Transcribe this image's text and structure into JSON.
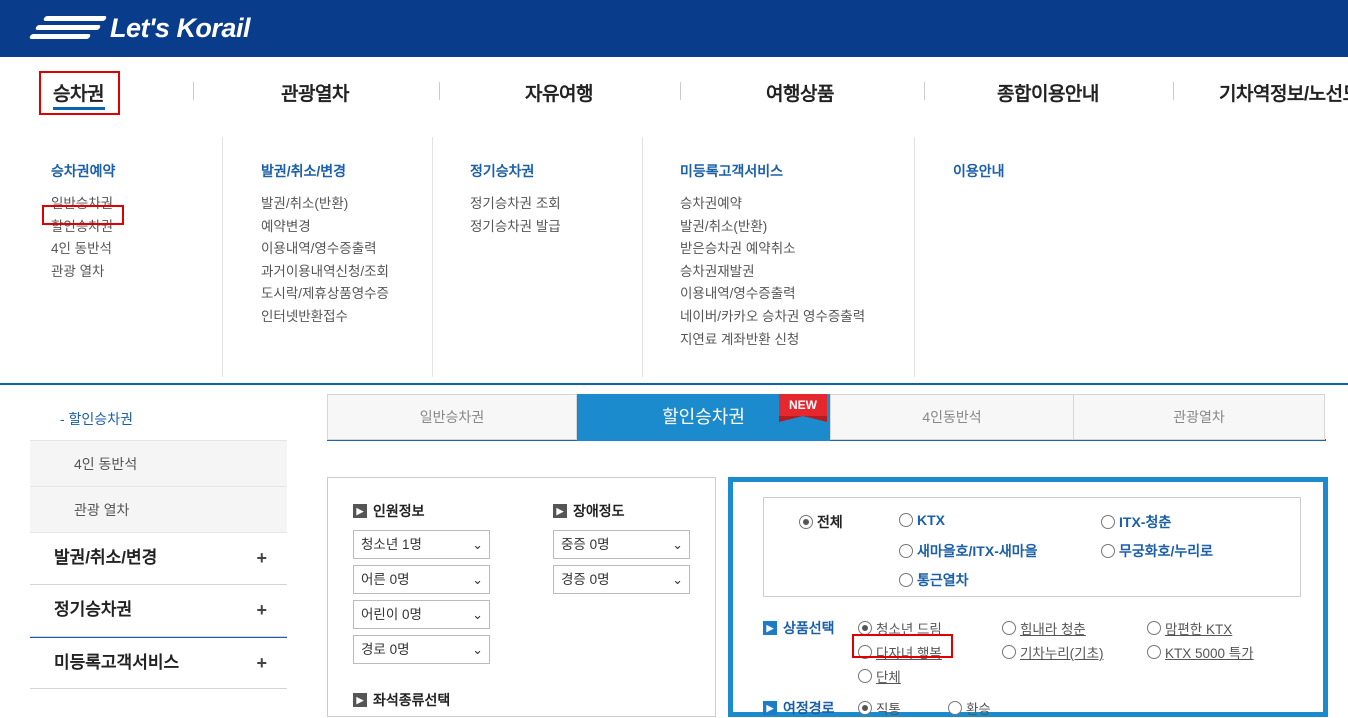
{
  "header": {
    "logo_text": "Let's Korail"
  },
  "gnb": [
    "승차권",
    "관광열차",
    "자유여행",
    "여행상품",
    "종합이용안내",
    "기차역정보/노선도"
  ],
  "mega": [
    {
      "title": "승차권예약",
      "items": [
        "일반승차권",
        "할인승차권",
        "4인 동반석",
        "관광 열차"
      ]
    },
    {
      "title": "발권/취소/변경",
      "items": [
        "발권/취소(반환)",
        "예약변경",
        "이용내역/영수증출력",
        "과거이용내역신청/조회",
        "도시락/제휴상품영수증",
        "인터넷반환접수"
      ]
    },
    {
      "title": "정기승차권",
      "items": [
        "정기승차권 조회",
        "정기승차권 발급"
      ]
    },
    {
      "title": "미등록고객서비스",
      "items": [
        "승차권예약",
        "발권/취소(반환)",
        "받은승차권 예약취소",
        "승차권재발권",
        "이용내역/영수증출력",
        "네이버/카카오 승차권 영수증출력",
        "지연료 계좌반환 신청"
      ]
    },
    {
      "title": "이용안내",
      "items": []
    }
  ],
  "lnb": {
    "sub": [
      "- 할인승차권",
      "4인 동반석",
      "관광 열차"
    ],
    "main": [
      "발권/취소/변경",
      "정기승차권",
      "미등록고객서비스"
    ],
    "plus": "+"
  },
  "tabs": [
    "일반승차권",
    "할인승차권",
    "4인동반석",
    "관광열차"
  ],
  "new_badge": "NEW",
  "left_panel": {
    "people_title": "인원정보",
    "disability_title": "장애정도",
    "people_selects": [
      "청소년 1명",
      "어른 0명",
      "어린이 0명",
      "경로 0명"
    ],
    "disability_selects": [
      "중증 0명",
      "경증 0명"
    ],
    "seat_title": "좌석종류선택"
  },
  "right_panel": {
    "categories": [
      "전체",
      "KTX",
      "ITX-청춘",
      "새마을호/ITX-새마을",
      "무궁화호/누리로",
      "통근열차"
    ],
    "product_title": "상품선택",
    "products": [
      "청소년 드림",
      "힘내라 청춘",
      "맘편한 KTX",
      "다자녀 행복",
      "기차누리(기초)",
      "KTX 5000 특가",
      "단체"
    ],
    "route_title": "여정경로",
    "route_options": [
      "직통",
      "환승"
    ]
  }
}
